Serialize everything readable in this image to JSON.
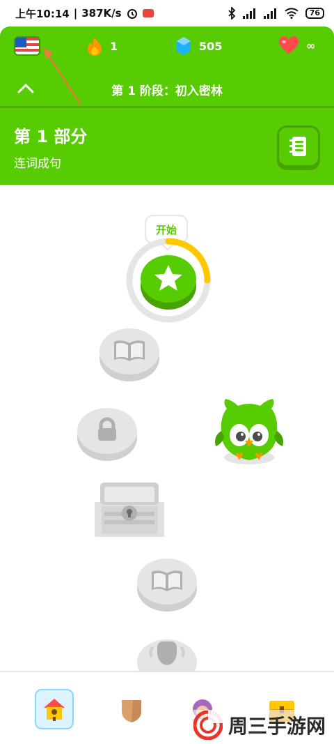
{
  "status_bar": {
    "time": "上午10:14",
    "network_speed": "387K/s",
    "battery": "76"
  },
  "header": {
    "streak_count": "1",
    "gem_count": "505",
    "hearts": "∞",
    "unit_title": "第 1 阶段：初入密林",
    "section_title": "第 1 部分",
    "section_subtitle": "连词成句"
  },
  "path": {
    "start_tooltip": "开始",
    "start_progress": 0.25
  },
  "watermark": {
    "text": "周三手游网"
  },
  "colors": {
    "green": "#58cc02",
    "dark_green": "#46a302",
    "yellow": "#ffc800",
    "gray_node": "#e5e5e5"
  },
  "icons": {
    "flag": "us-flag-icon",
    "streak": "fire-icon",
    "gems": "gem-icon",
    "hearts": "heart-icon",
    "guide": "guidebook-icon",
    "start": "star-icon",
    "lesson": "book-icon",
    "locked": "lock-icon",
    "chest": "chest-icon",
    "trophy": "trophy-icon"
  }
}
